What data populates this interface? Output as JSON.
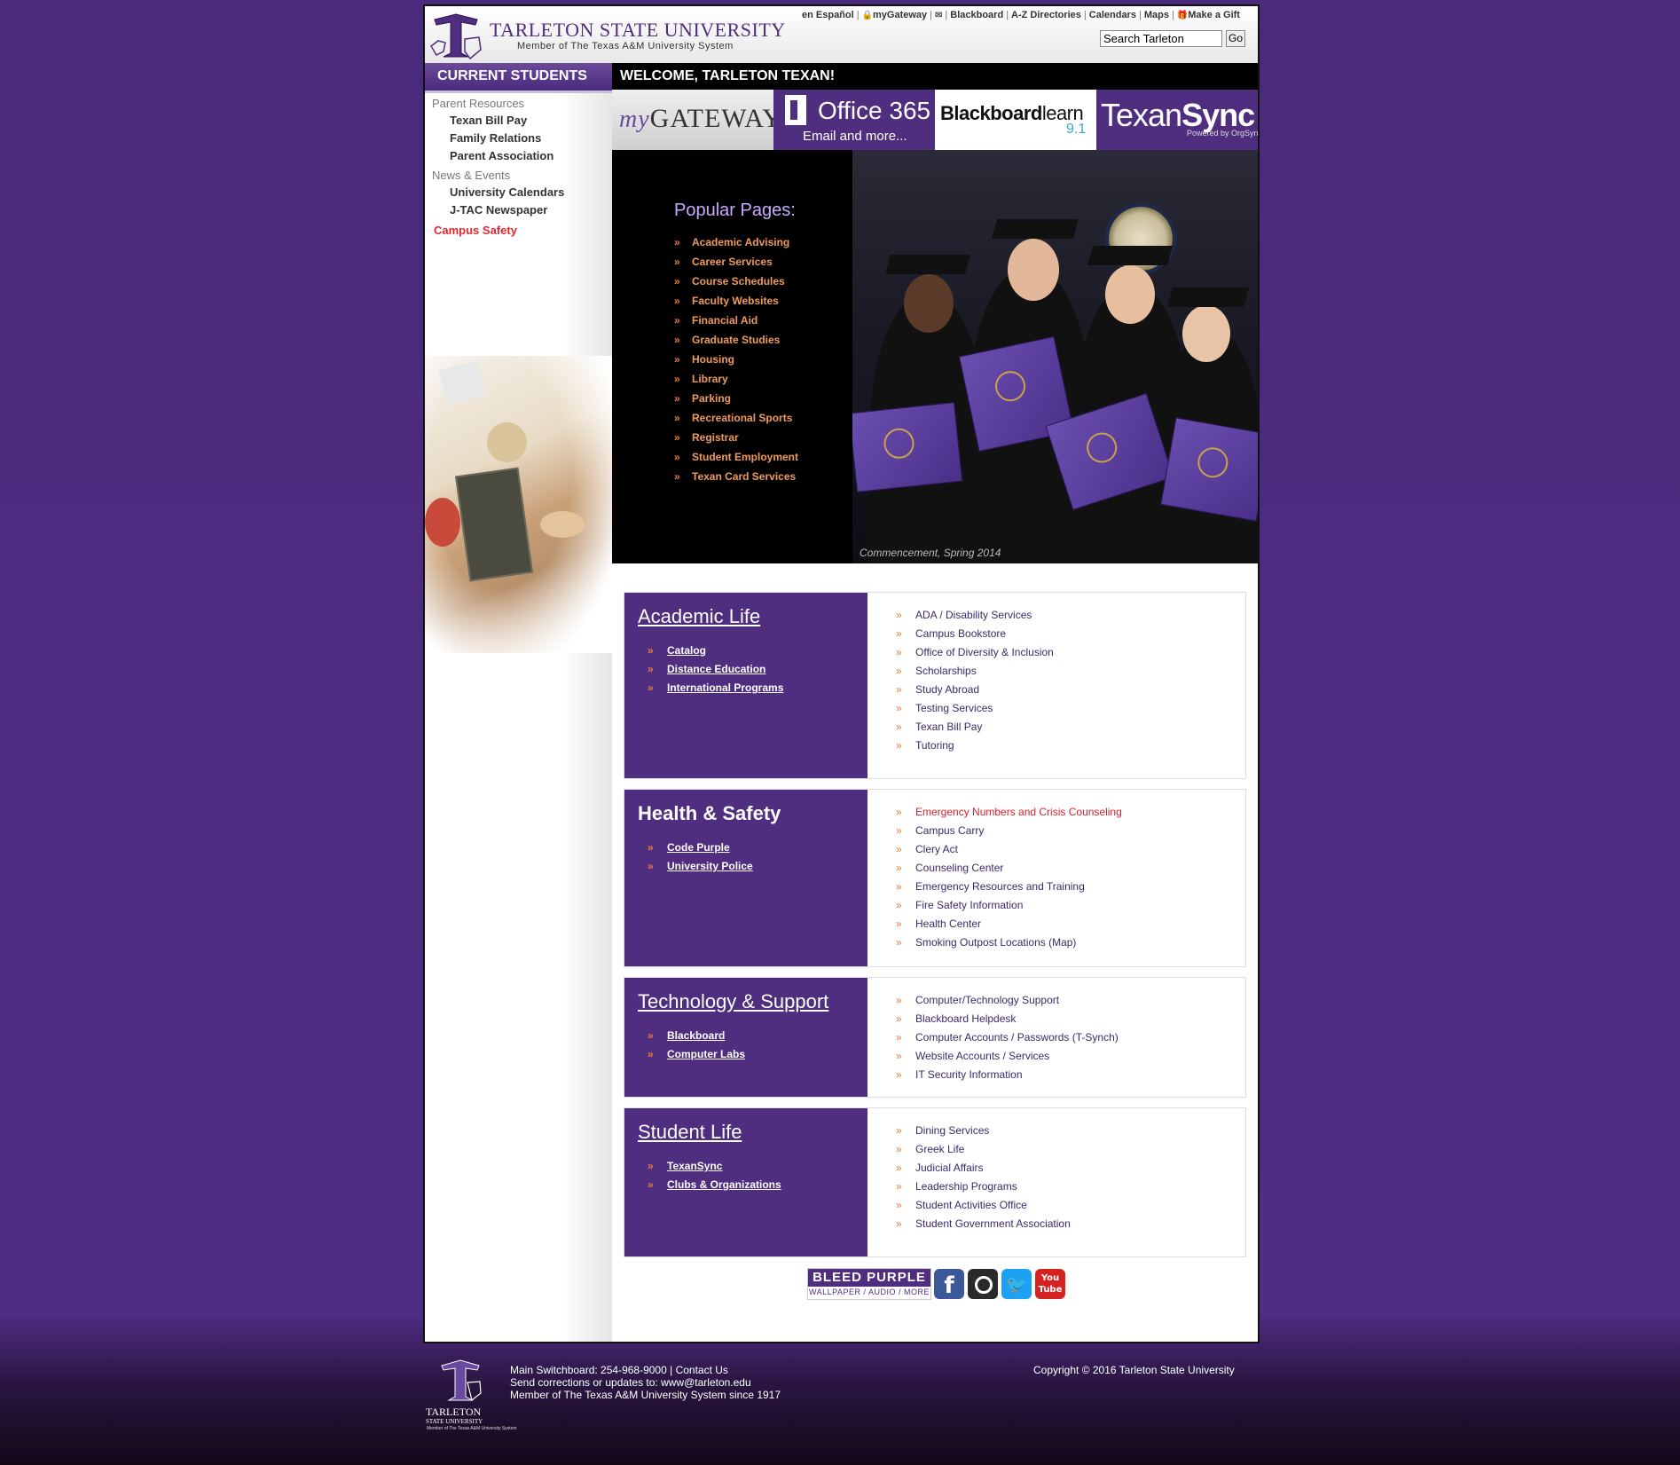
{
  "header": {
    "university_name": "TARLETON STATE UNIVERSITY",
    "university_sub": "Member of The Texas A&M University System",
    "top_links": [
      "en Español",
      "myGateway",
      "Blackboard",
      "A-Z Directories",
      "Calendars",
      "Maps",
      "Make a Gift"
    ],
    "search": {
      "value": "Search Tarleton",
      "go_label": "Go"
    }
  },
  "sidebar": {
    "title": "CURRENT STUDENTS",
    "groups": [
      {
        "heading": "Parent Resources",
        "items": [
          "Texan Bill Pay",
          "Family Relations",
          "Parent Association"
        ]
      },
      {
        "heading": "News & Events",
        "items": [
          "University Calendars",
          "J-TAC Newspaper"
        ]
      }
    ],
    "highlight_link": "Campus Safety"
  },
  "welcome": "WELCOME, TARLETON TEXAN!",
  "tiles": {
    "gateway": {
      "prefix": "my",
      "name": "GATEWAY"
    },
    "office": {
      "name": "Office 365",
      "sub": "Email and more..."
    },
    "blackboard": {
      "name": "Blackboard",
      "learn": "learn",
      "version": "9.1"
    },
    "texansync": {
      "name": "Texan",
      "sync": "Sync",
      "powered": "Powered by OrgSync"
    }
  },
  "hero": {
    "popular_title": "Popular Pages:",
    "popular_links": [
      "Academic Advising",
      "Career Services",
      "Course Schedules",
      "Faculty Websites",
      "Financial Aid",
      "Graduate Studies",
      "Housing",
      "Library",
      "Parking",
      "Recreational Sports",
      "Registrar",
      "Student Employment",
      "Texan Card Services"
    ],
    "caption": "Commencement, Spring 2014"
  },
  "sections": [
    {
      "title": "Academic Life",
      "left_links": [
        "Catalog",
        "Distance Education",
        "International Programs"
      ],
      "right_links": [
        "ADA / Disability Services",
        "Campus Bookstore",
        "Office of Diversity & Inclusion",
        "Scholarships",
        "Study Abroad",
        "Testing Services",
        "Texan Bill Pay",
        "Tutoring"
      ]
    },
    {
      "title": "Health & Safety",
      "left_links": [
        "Code Purple",
        "University Police"
      ],
      "right_links": [
        "Emergency Numbers and Crisis Counseling",
        "Campus Carry",
        "Clery Act",
        "Counseling Center",
        "Emergency Resources and Training",
        "Fire Safety Information",
        "Health Center",
        "Smoking Outpost Locations (Map)"
      ]
    },
    {
      "title": "Technology & Support",
      "left_links": [
        "Blackboard",
        "Computer Labs"
      ],
      "right_links": [
        "Computer/Technology Support",
        "Blackboard Helpdesk",
        "Computer Accounts / Passwords (T-Synch)",
        "Website Accounts / Services",
        "IT Security Information"
      ]
    },
    {
      "title": "Student Life",
      "left_links": [
        "TexanSync",
        "Clubs & Organizations"
      ],
      "right_links": [
        "Dining Services",
        "Greek Life",
        "Judicial Affairs",
        "Leadership Programs",
        "Student Activities Office",
        "Student Government Association"
      ]
    }
  ],
  "social": {
    "bleed_title": "BLEED PURPLE",
    "bleed_sub": "WALLPAPER / AUDIO / MORE",
    "facebook": "f",
    "twitter": "🐦",
    "youtube_top": "You",
    "youtube_bottom": "Tube"
  },
  "footer": {
    "logo_name": "TARLETON",
    "logo_sub": "STATE UNIVERSITY",
    "logo_member": "Member of The Texas A&M University System",
    "switchboard": "Main Switchboard: 254-968-9000",
    "contact": "Contact Us",
    "corrections": "Send corrections or updates to: www@tarleton.edu",
    "member": "Member of The Texas A&M University System since 1917",
    "copyright": "Copyright © 2016 Tarleton State University"
  },
  "colors": {
    "purple": "#4f2d7f",
    "orange_accent": "#f07838",
    "red_link": "#d8202a"
  },
  "icons": [
    "lock-icon",
    "mail-icon",
    "gift-icon",
    "chevron-right-icon",
    "facebook-icon",
    "instagram-icon",
    "twitter-icon",
    "youtube-icon"
  ]
}
